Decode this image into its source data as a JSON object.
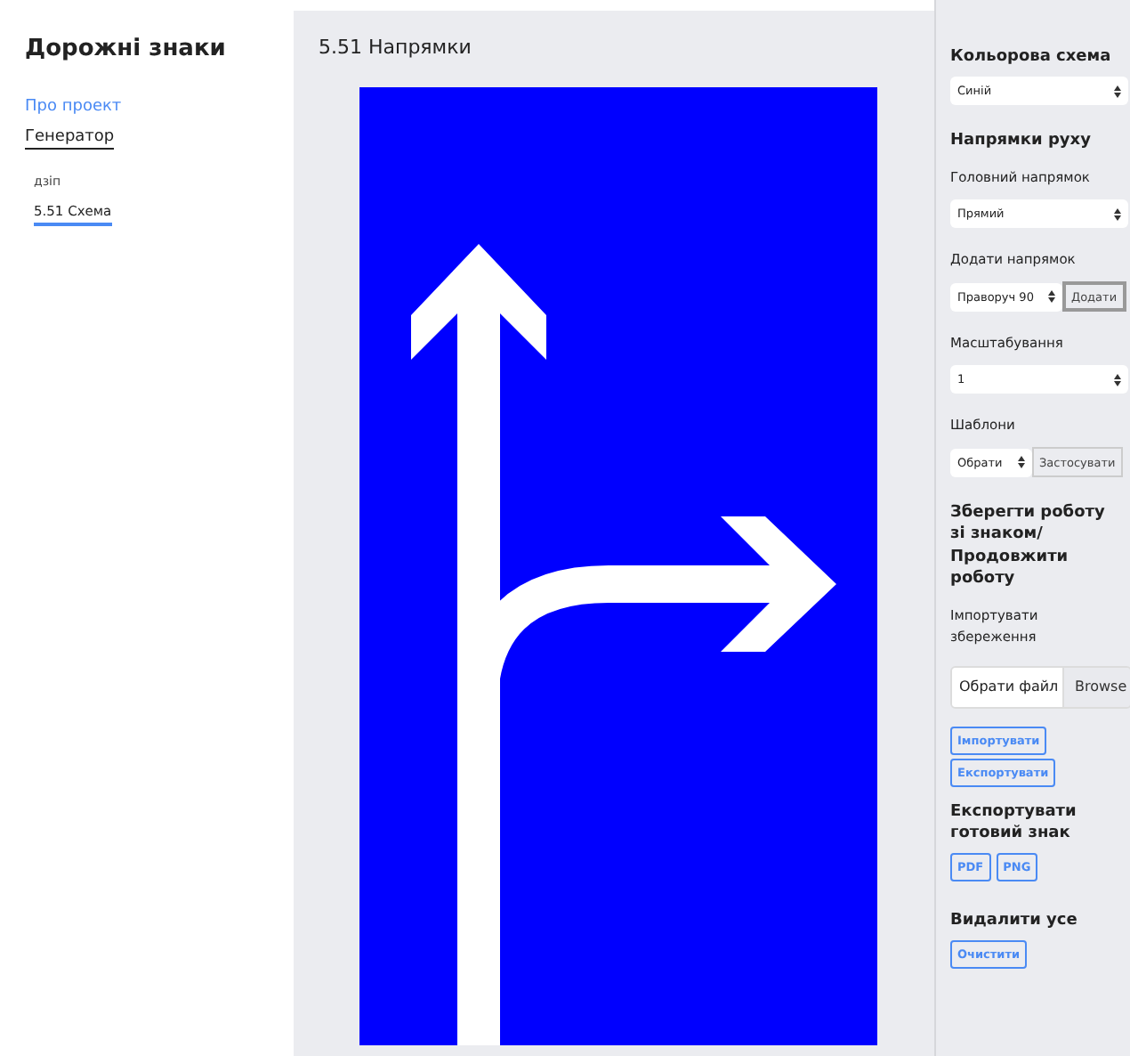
{
  "sidebar": {
    "title": "Дорожні знаки",
    "nav": [
      {
        "label": "Про проект",
        "selected": false
      },
      {
        "label": "Генератор",
        "selected": true
      }
    ],
    "group": "дзіп",
    "items": [
      {
        "label": "5.51 Схема",
        "selected": true
      }
    ]
  },
  "main": {
    "title": "5.51 Напрямки"
  },
  "panel": {
    "color_scheme": {
      "title": "Кольорова схема",
      "value": "Синій"
    },
    "directions": {
      "title": "Напрямки руху",
      "main_label": "Головний напрямок",
      "main_value": "Прямий",
      "add_label": "Додати напрямок",
      "add_value": "Праворуч 90",
      "add_button": "Додати"
    },
    "scale": {
      "label": "Масштабування",
      "value": "1"
    },
    "templates": {
      "label": "Шаблони",
      "value": "Обрати",
      "button": "Застосувати"
    },
    "save": {
      "title": "Зберегти роботу зі знаком/ Продовжити роботу",
      "import_label": "Імпортувати збереження",
      "file_placeholder": "Обрати файл",
      "browse": "Browse",
      "buttons": [
        "Імпортувати",
        "Експортувати"
      ]
    },
    "export": {
      "title": "Експортувати готовий знак",
      "buttons": [
        "PDF",
        "PNG"
      ]
    },
    "clear": {
      "title": "Видалити усе",
      "button": "Очистити"
    }
  }
}
